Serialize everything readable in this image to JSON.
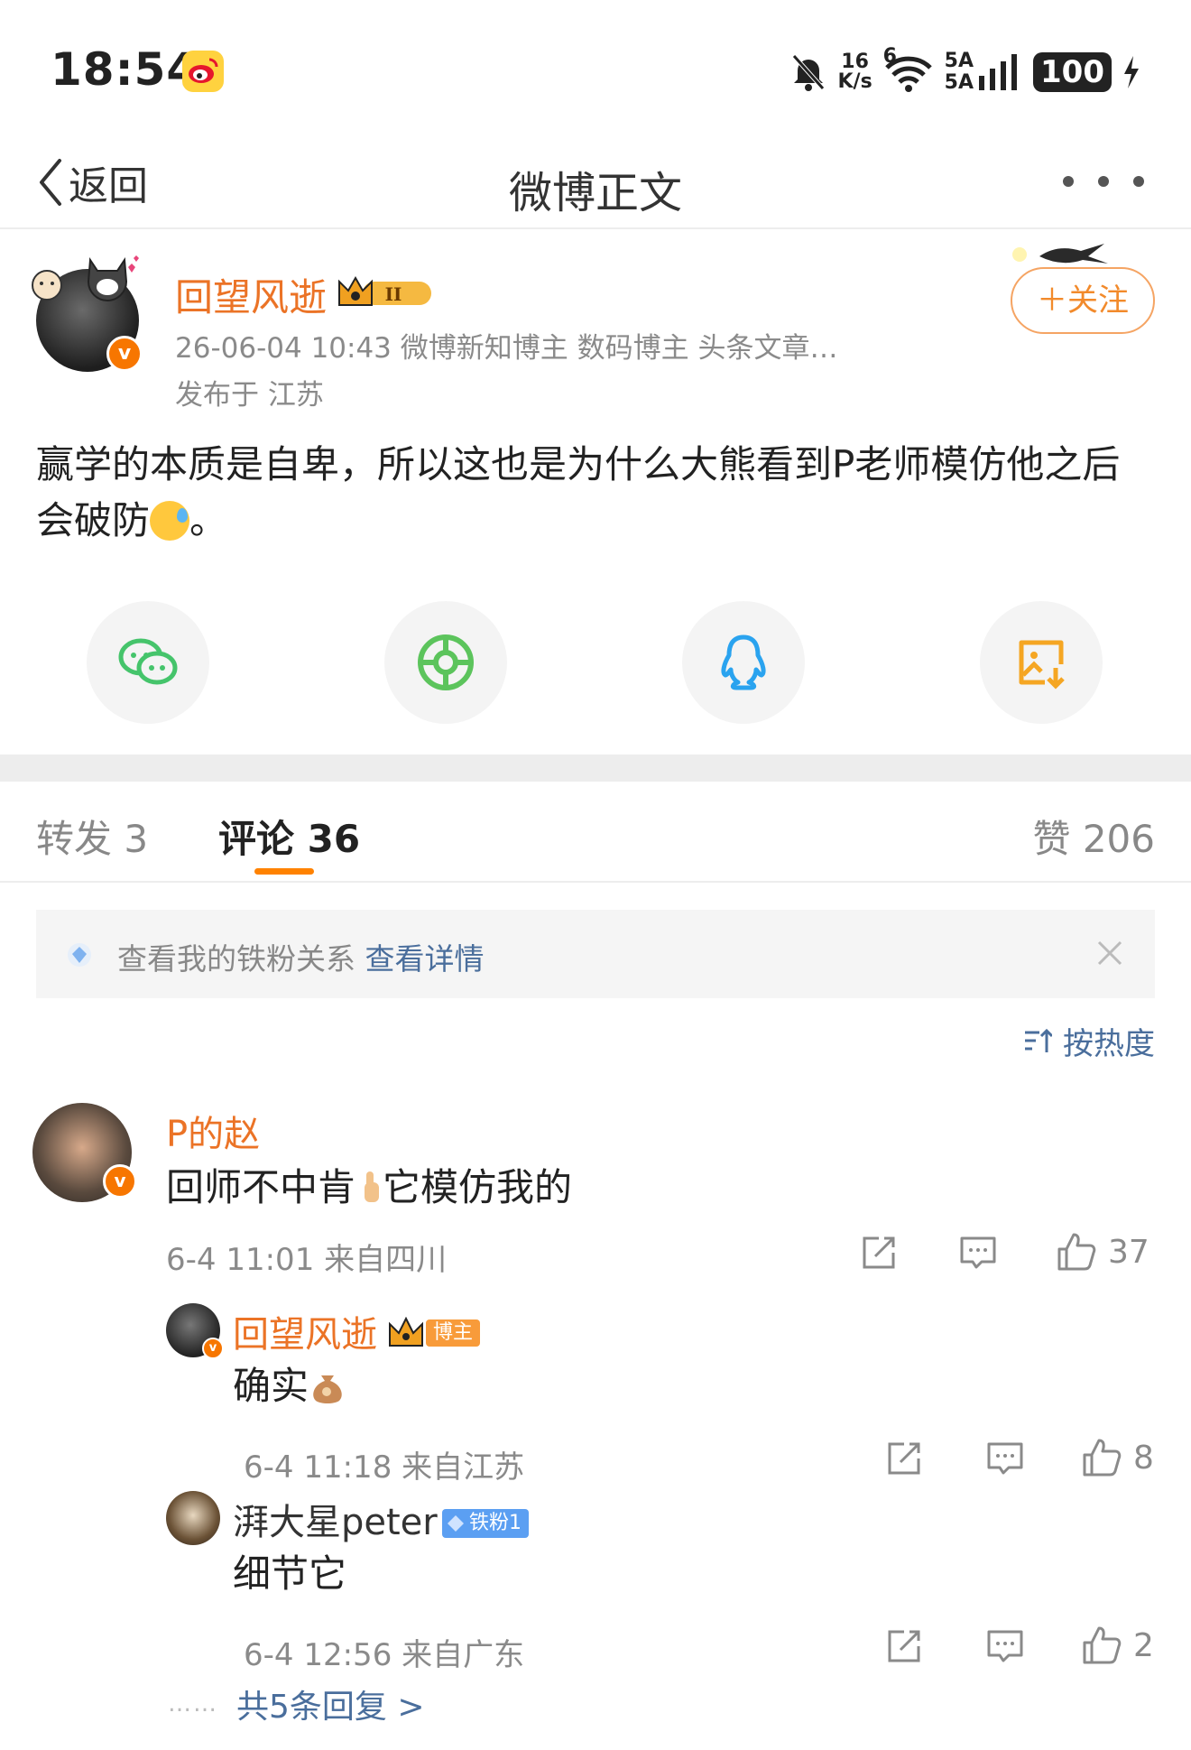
{
  "status_bar": {
    "time": "18:54",
    "net_speed_value": "16",
    "net_speed_unit": "K/s",
    "wifi_label": "6",
    "signal_label_1": "5A",
    "signal_label_2": "5A",
    "battery": "100"
  },
  "nav": {
    "back_label": "返回",
    "title": "微博正文"
  },
  "post": {
    "author": "回望风逝",
    "meta": "26-06-04 10:43  微博新知博主 数码博主 头条文章…",
    "location": "发布于 江苏",
    "follow_label": "＋关注",
    "verified_mark": "v",
    "level_badge": "II",
    "body_text": "赢学的本质是自卑，所以这也是为什么大熊看到P老师模仿他之后会破防",
    "body_end": "。"
  },
  "share": {
    "icons": [
      "wechat-icon",
      "moments-icon",
      "qq-icon",
      "save-image-icon"
    ],
    "colors": {
      "wechat": "#45c46b",
      "moments": "#5cc45c",
      "qq": "#2aa3ef",
      "save": "#f5a623"
    }
  },
  "tabs": {
    "repost": "转发 3",
    "comment": "评论 36",
    "like": "赞 206"
  },
  "fan_banner": {
    "text": "查看我的铁粉关系 ",
    "link": "查看详情"
  },
  "sort": {
    "label": "按热度"
  },
  "comment": {
    "author": "P的赵",
    "text_before": "回师不中肯",
    "text_after": "它模仿我的",
    "time": "6-4 11:01 来自四川",
    "likes": "37",
    "verified_mark": "v"
  },
  "replies": [
    {
      "author": "回望风逝",
      "badge": "博主",
      "text": "确实",
      "time": "6-4 11:18 来自江苏",
      "likes": "8",
      "verified_mark": "v"
    },
    {
      "author": "湃大星peter",
      "badge": "铁粉1",
      "text": "细节它",
      "time": "6-4 12:56 来自广东",
      "likes": "2"
    }
  ],
  "more_replies": {
    "dots": "……",
    "label": "共5条回复 >"
  },
  "colors": {
    "accent_orange": "#ff8200",
    "username_orange": "#eb7326",
    "link_blue": "#4a6e9c"
  }
}
